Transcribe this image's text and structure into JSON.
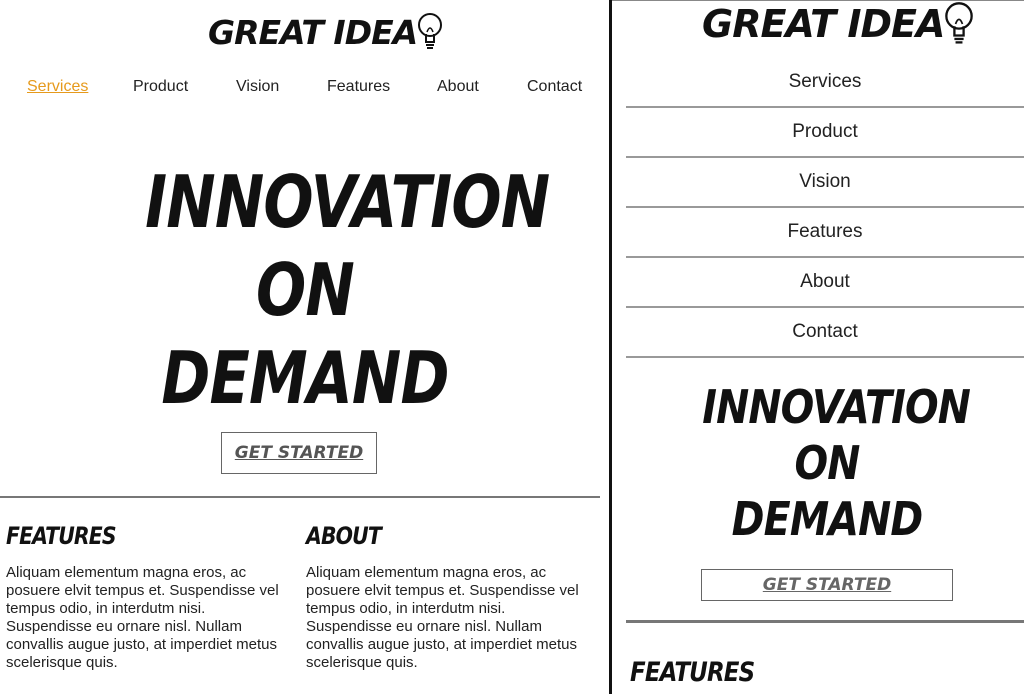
{
  "brand": {
    "logo_text": "GREAT IDEA",
    "logo_icon": "lightbulb-icon"
  },
  "nav": {
    "items": [
      "Services",
      "Product",
      "Vision",
      "Features",
      "About",
      "Contact"
    ],
    "active_index": 0,
    "active_color": "#e69a1c"
  },
  "hero": {
    "line1": "INNOVATION",
    "line2": "ON",
    "line3": "DEMAND",
    "cta_label": "GET STARTED"
  },
  "sections": {
    "features": {
      "title": "FEATURES",
      "body": "Aliquam elementum magna eros, ac posuere elvit tempus et. Suspendisse vel tempus odio, in interdutm nisi. Suspendisse eu ornare nisl. Nullam convallis augue justo, at imperdiet metus scelerisque quis."
    },
    "about": {
      "title": "ABOUT",
      "body": "Aliquam elementum magna eros, ac posuere elvit tempus et. Suspendisse vel tempus odio, in interdutm nisi. Suspendisse eu ornare nisl. Nullam convallis augue justo, at imperdiet metus scelerisque quis."
    }
  }
}
